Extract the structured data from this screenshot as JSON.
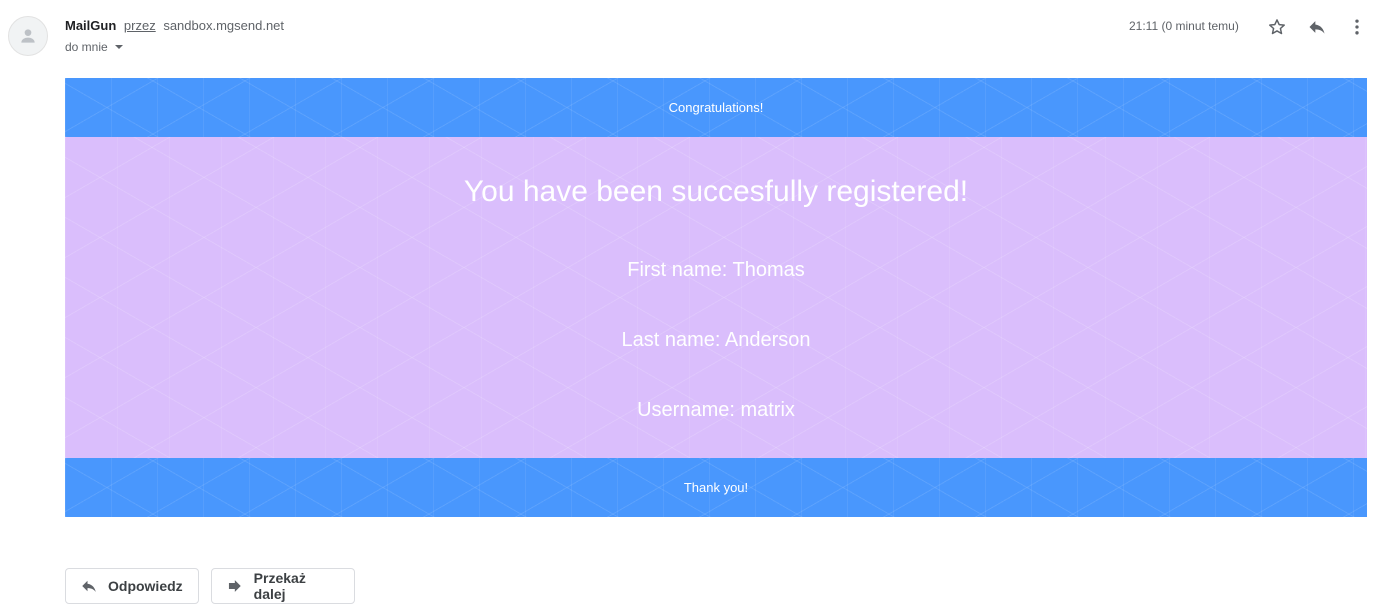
{
  "header": {
    "sender_name": "MailGun",
    "via_label": "przez",
    "sender_domain": "sandbox.mgsend.net",
    "recipient_label": "do mnie",
    "timestamp": "21:11 (0 minut temu)"
  },
  "email": {
    "banner_top": "Congratulations!",
    "headline": "You have been succesfully registered!",
    "fields": [
      "First name: Thomas",
      "Last name: Anderson",
      "Username: matrix"
    ],
    "banner_bottom": "Thank you!"
  },
  "actions": {
    "reply_label": "Odpowiedz",
    "forward_label": "Przekaż dalej"
  },
  "icons": {
    "avatar": "person-icon",
    "star": "star-icon",
    "reply": "reply-icon",
    "more": "more-vert-icon",
    "forward": "forward-icon",
    "dropdown": "caret-down-icon"
  },
  "colors": {
    "banner": "#4997fd",
    "content": "#dabefc"
  }
}
